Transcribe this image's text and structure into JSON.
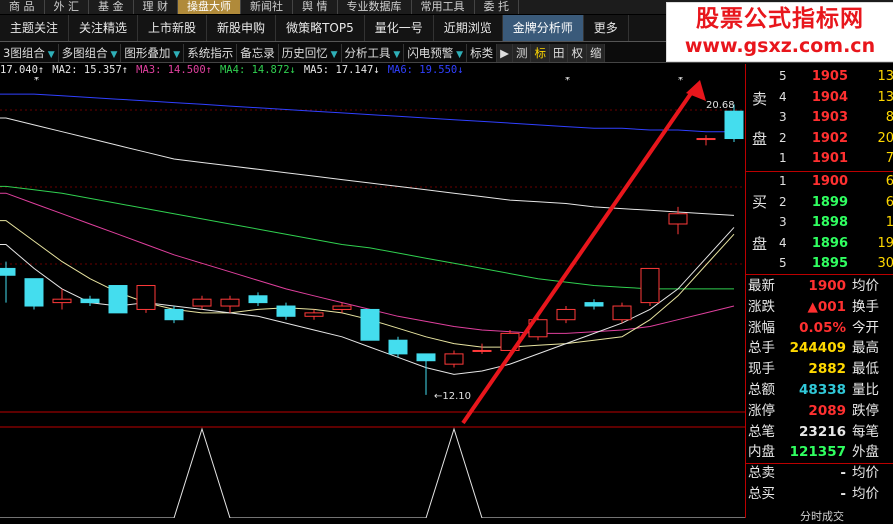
{
  "menu": [
    "商 品",
    "外 汇",
    "基 金",
    "理 财",
    "操盘大师",
    "新闻社",
    "舆 情",
    "专业数据库",
    "常用工具",
    "委 托"
  ],
  "menu_highlight": 4,
  "tabs": [
    "主题关注",
    "关注精选",
    "上市新股",
    "新股申购",
    "微策略TOP5",
    "量化一号",
    "近期浏览",
    "金牌分析师",
    "更多"
  ],
  "tabs_active": 7,
  "toolbar": {
    "items": [
      "3图组合",
      "多图组合",
      "图形叠加",
      "系统指示",
      "备忘录",
      "历史回忆",
      "分析工具",
      "闪电预警",
      "标类"
    ],
    "drop_after": [
      0,
      1,
      2,
      5,
      6,
      7
    ],
    "buttons": [
      "▶",
      "测",
      "标",
      "田",
      "权",
      "缩"
    ]
  },
  "watermark": {
    "title": "股票公式指标网",
    "url": "www.gsxz.com.cn"
  },
  "ma_legend": [
    {
      "text": "17.040↑",
      "color": "#e6e6e6"
    },
    {
      "text": "MA2: 15.357↑",
      "color": "#e6e6e6"
    },
    {
      "text": "MA3: 14.500↑",
      "color": "#e0409e"
    },
    {
      "text": "MA4: 14.872↓",
      "color": "#30d050"
    },
    {
      "text": "MA5: 17.147↓",
      "color": "#e6e6e6"
    },
    {
      "text": "MA6: 19.550↓",
      "color": "#3040ff"
    }
  ],
  "chart_data": {
    "type": "candlestick",
    "y_range": [
      11.6,
      21.4
    ],
    "candles": [
      {
        "o": 15.8,
        "c": 15.6,
        "h": 16.0,
        "l": 14.8
      },
      {
        "o": 15.5,
        "c": 14.7,
        "h": 15.5,
        "l": 14.6
      },
      {
        "o": 14.8,
        "c": 14.9,
        "h": 15.2,
        "l": 14.6
      },
      {
        "o": 14.9,
        "c": 14.8,
        "h": 15.0,
        "l": 14.7
      },
      {
        "o": 15.3,
        "c": 14.5,
        "h": 15.3,
        "l": 14.5
      },
      {
        "o": 14.6,
        "c": 15.3,
        "h": 15.3,
        "l": 14.5
      },
      {
        "o": 14.6,
        "c": 14.3,
        "h": 14.7,
        "l": 14.2
      },
      {
        "o": 14.7,
        "c": 14.9,
        "h": 15.0,
        "l": 14.6
      },
      {
        "o": 14.7,
        "c": 14.9,
        "h": 15.0,
        "l": 14.5
      },
      {
        "o": 15.0,
        "c": 14.8,
        "h": 15.1,
        "l": 14.7
      },
      {
        "o": 14.7,
        "c": 14.4,
        "h": 14.8,
        "l": 14.3
      },
      {
        "o": 14.4,
        "c": 14.5,
        "h": 14.6,
        "l": 14.3
      },
      {
        "o": 14.6,
        "c": 14.7,
        "h": 14.8,
        "l": 14.5
      },
      {
        "o": 14.6,
        "c": 13.7,
        "h": 14.6,
        "l": 13.7
      },
      {
        "o": 13.7,
        "c": 13.3,
        "h": 13.8,
        "l": 13.2
      },
      {
        "o": 13.3,
        "c": 13.1,
        "h": 13.3,
        "l": 12.1
      },
      {
        "o": 13.0,
        "c": 13.3,
        "h": 13.4,
        "l": 12.9
      },
      {
        "o": 13.4,
        "c": 13.4,
        "h": 13.6,
        "l": 13.3
      },
      {
        "o": 13.4,
        "c": 13.9,
        "h": 14.0,
        "l": 13.4
      },
      {
        "o": 13.8,
        "c": 14.3,
        "h": 14.4,
        "l": 13.7
      },
      {
        "o": 14.3,
        "c": 14.6,
        "h": 14.7,
        "l": 14.2
      },
      {
        "o": 14.8,
        "c": 14.7,
        "h": 14.9,
        "l": 14.6
      },
      {
        "o": 14.3,
        "c": 14.7,
        "h": 14.8,
        "l": 14.2
      },
      {
        "o": 14.8,
        "c": 15.8,
        "h": 15.8,
        "l": 14.7
      },
      {
        "o": 17.1,
        "c": 17.4,
        "h": 17.6,
        "l": 16.8
      },
      {
        "o": 19.6,
        "c": 19.6,
        "h": 19.7,
        "l": 19.4
      },
      {
        "o": 20.4,
        "c": 19.6,
        "h": 20.6,
        "l": 19.5
      }
    ],
    "ma_series": [
      {
        "color": "#e6e6e6",
        "values": [
          20.2,
          20.0,
          19.8,
          19.6,
          19.4,
          19.2,
          19.0,
          18.9,
          18.8,
          18.7,
          18.6,
          18.5,
          18.4,
          18.3,
          18.2,
          18.1,
          18.0,
          17.9,
          17.8,
          17.75,
          17.7,
          17.6,
          17.55,
          17.5,
          17.45,
          17.4,
          17.35
        ]
      },
      {
        "color": "#30d050",
        "values": [
          18.2,
          18.1,
          18.0,
          17.85,
          17.7,
          17.55,
          17.4,
          17.25,
          17.1,
          16.95,
          16.8,
          16.65,
          16.5,
          16.4,
          16.25,
          16.1,
          15.95,
          15.8,
          15.65,
          15.5,
          15.4,
          15.3,
          15.25,
          15.2,
          15.2,
          15.2,
          15.2
        ]
      },
      {
        "color": "#e0409e",
        "values": [
          18.0,
          17.7,
          17.4,
          17.1,
          16.8,
          16.5,
          16.2,
          15.95,
          15.7,
          15.45,
          15.2,
          15.0,
          14.8,
          14.6,
          14.4,
          14.25,
          14.1,
          14.0,
          13.95,
          13.9,
          13.9,
          13.95,
          14.0,
          14.1,
          14.3,
          14.5,
          14.7
        ]
      },
      {
        "color": "#e8e4a0",
        "values": [
          17.2,
          16.6,
          16.0,
          15.5,
          15.1,
          14.8,
          14.6,
          14.5,
          14.5,
          14.6,
          14.65,
          14.6,
          14.5,
          14.3,
          14.05,
          13.8,
          13.6,
          13.5,
          13.5,
          13.55,
          13.6,
          13.7,
          13.8,
          14.3,
          15.0,
          15.9,
          16.8
        ]
      },
      {
        "color": "#e6e6e6",
        "values": [
          16.5,
          15.8,
          15.2,
          14.8,
          14.7,
          14.8,
          14.7,
          14.6,
          14.5,
          14.4,
          14.2,
          14.0,
          13.8,
          13.5,
          13.2,
          12.9,
          12.7,
          12.8,
          13.0,
          13.3,
          13.6,
          13.9,
          14.2,
          14.6,
          15.2,
          16.1,
          17.0
        ]
      },
      {
        "color": "#3040ff",
        "values": [
          20.9,
          20.9,
          20.85,
          20.8,
          20.75,
          20.7,
          20.65,
          20.6,
          20.55,
          20.5,
          20.45,
          20.4,
          20.35,
          20.3,
          20.25,
          20.2,
          20.15,
          20.1,
          20.05,
          20.0,
          19.95,
          19.9,
          19.9,
          19.85,
          19.85,
          19.8,
          19.8
        ]
      }
    ],
    "annotations": {
      "high_label": "20.68",
      "low_label": "12.10"
    },
    "indicator": {
      "values": [
        0,
        0,
        0,
        0,
        0,
        0,
        0,
        1,
        0,
        0,
        0,
        0,
        0,
        0,
        0,
        0,
        1,
        0,
        0,
        0,
        0,
        0,
        0,
        0,
        0,
        0,
        0
      ],
      "color": "#e6e6e6"
    }
  },
  "order_book": {
    "sell_label_1": "卖",
    "sell_label_2": "盘",
    "buy_label_1": "买",
    "buy_label_2": "盘",
    "sell": [
      {
        "level": "5",
        "price": "1905",
        "vol": "13"
      },
      {
        "level": "4",
        "price": "1904",
        "vol": "13"
      },
      {
        "level": "3",
        "price": "1903",
        "vol": "8"
      },
      {
        "level": "2",
        "price": "1902",
        "vol": "20"
      },
      {
        "level": "1",
        "price": "1901",
        "vol": "7"
      }
    ],
    "buy": [
      {
        "level": "1",
        "price": "1900",
        "vol": "6"
      },
      {
        "level": "2",
        "price": "1899",
        "vol": "6"
      },
      {
        "level": "3",
        "price": "1898",
        "vol": "1"
      },
      {
        "level": "4",
        "price": "1896",
        "vol": "19"
      },
      {
        "level": "5",
        "price": "1895",
        "vol": "30"
      }
    ]
  },
  "stats": [
    {
      "label": "最新",
      "value": "1900",
      "vcolor": "#ff3030",
      "right": "均价"
    },
    {
      "label": "涨跌",
      "value": "▲001",
      "vcolor": "#ff3030",
      "right": "换手"
    },
    {
      "label": "涨幅",
      "value": "0.05%",
      "vcolor": "#ff3030",
      "right": "今开"
    },
    {
      "label": "总手",
      "value": "244409",
      "vcolor": "#ffd800",
      "right": "最高"
    },
    {
      "label": "现手",
      "value": "2882",
      "vcolor": "#ffd800",
      "right": "最低"
    },
    {
      "label": "总额",
      "value": "48338",
      "vcolor": "#30c8d8",
      "right": "量比"
    },
    {
      "label": "涨停",
      "value": "2089",
      "vcolor": "#ff3030",
      "right": "跌停"
    },
    {
      "label": "总笔",
      "value": "23216",
      "vcolor": "#e8e8e8",
      "right": "每笔"
    },
    {
      "label": "内盘",
      "value": "121357",
      "vcolor": "#30ff60",
      "right": "外盘"
    },
    {
      "label": "总卖",
      "value": "-",
      "vcolor": "#e8e8e8",
      "right": "均价"
    },
    {
      "label": "总买",
      "value": "-",
      "vcolor": "#e8e8e8",
      "right": "均价"
    }
  ],
  "bottom_tab": "分时成交"
}
